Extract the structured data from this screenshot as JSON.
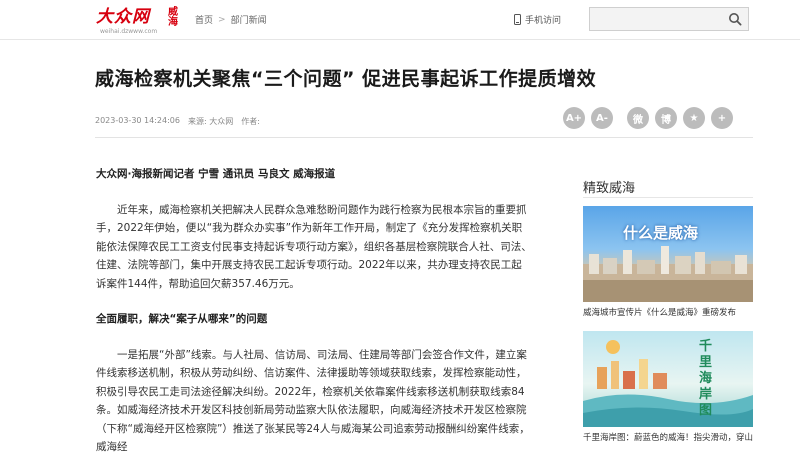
{
  "header": {
    "logo_text": "大众网",
    "logo_city": "威海",
    "logo_url_text": "weihai.dzwww.com",
    "breadcrumb": [
      "首页",
      "部门新闻"
    ],
    "breadcrumb_sep": ">",
    "mobile_label": "手机访问",
    "search_placeholder": "",
    "icons": {
      "mobile": "phone-icon",
      "search": "search-icon"
    }
  },
  "article": {
    "title": "威海检察机关聚焦“三个问题” 促进民事起诉工作提质增效",
    "date": "2023-03-30 14:24:06",
    "source": "来源: 大众网",
    "author": "作者:",
    "tools": [
      {
        "name": "font-increase-icon",
        "glyph": "A+"
      },
      {
        "name": "font-decrease-icon",
        "glyph": "A-"
      },
      {
        "name": "wechat-icon",
        "glyph": "微"
      },
      {
        "name": "weibo-icon",
        "glyph": "博"
      },
      {
        "name": "star-icon",
        "glyph": "★"
      },
      {
        "name": "more-icon",
        "glyph": "+"
      }
    ],
    "byline": "大众网·海报新闻记者 宁雪 通讯员 马良文 威海报道",
    "p1": "近年来，威海检察机关把解决人民群众急难愁盼问题作为践行检察为民根本宗旨的重要抓手，2022年伊始，便以“我为群众办实事”作为新年工作开局，制定了《充分发挥检察机关职能依法保障农民工工资支付民事支持起诉专项行动方案》，组织各基层检察院联合人社、司法、住建、法院等部门，集中开展支持农民工起诉专项行动。2022年以来，共办理支持农民工起诉案件144件，帮助追回欠薪357.46万元。",
    "heading1": "全面履职，解决“案子从哪来”的问题",
    "p2": "一是拓展“外部”线索。与人社局、信访局、司法局、住建局等部门会签合作文件，建立案件线索移送机制，积极从劳动纠纷、信访案件、法律援助等领域获取线索，发挥检察能动性，积极引导农民工走司法途径解决纠纷。2022年，检察机关依靠案件线索移送机制获取线索84条。如威海经济技术开发区科技创新局劳动监察大队依法履职，向威海经济技术开发区检察院（下称“威海经开区检察院”）推送了张某民等24人与威海某公司追索劳动报酬纠纷案件线索，威海经"
  },
  "sidebar": {
    "title": "精致威海",
    "cards": [
      {
        "caption": "威海城市宣传片《什么是威海》重磅发布",
        "image_text": "什么是威海"
      },
      {
        "caption": "千里海岸图：蔚蓝色的威海！指尖滑动，穿山越",
        "image_text": "千里海岸图"
      }
    ]
  },
  "colors": {
    "brand_red": "#d7000f",
    "tool_grey": "#bcbcbc"
  }
}
